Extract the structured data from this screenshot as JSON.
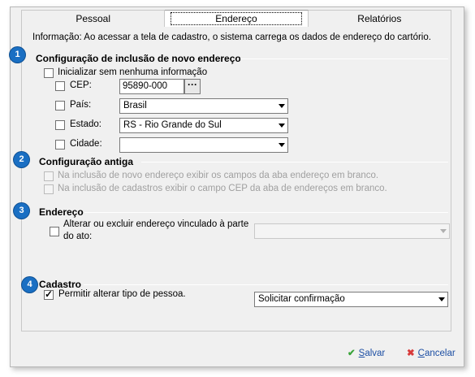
{
  "tabs": [
    {
      "label": "Pessoal"
    },
    {
      "label": "Endereço"
    },
    {
      "label": "Relatórios"
    }
  ],
  "info_text": "Informação: Ao acessar a tela de cadastro, o sistema carrega os dados de endereço do cartório.",
  "section1": {
    "badge": "1",
    "title": "Configuração de inclusão de novo endereço",
    "init_blank_label": "Inicializar sem nenhuma informação",
    "cep_label": "CEP:",
    "cep_value": "95890-000",
    "cep_button": "···",
    "pais_label": "País:",
    "pais_value": "Brasil",
    "estado_label": "Estado:",
    "estado_value": "RS - Rio Grande do Sul",
    "cidade_label": "Cidade:",
    "cidade_value": ""
  },
  "section2": {
    "badge": "2",
    "title": "Configuração antiga",
    "opt1": "Na inclusão de novo endereço exibir os campos da aba endereço em branco.",
    "opt2": "Na inclusão de cadastros exibir o campo CEP da aba de endereços em branco."
  },
  "section3": {
    "badge": "3",
    "title": "Endereço",
    "opt_line1": "Alterar ou excluir endereço vinculado à parte",
    "opt_line2": "do ato:",
    "select_value": ""
  },
  "section4": {
    "badge": "4",
    "title": "Cadastro",
    "opt": "Permitir alterar tipo de pessoa.",
    "select_value": "Solicitar confirmação"
  },
  "footer": {
    "save_first": "S",
    "save_rest": "alvar",
    "cancel_first": "C",
    "cancel_rest": "ancelar"
  }
}
